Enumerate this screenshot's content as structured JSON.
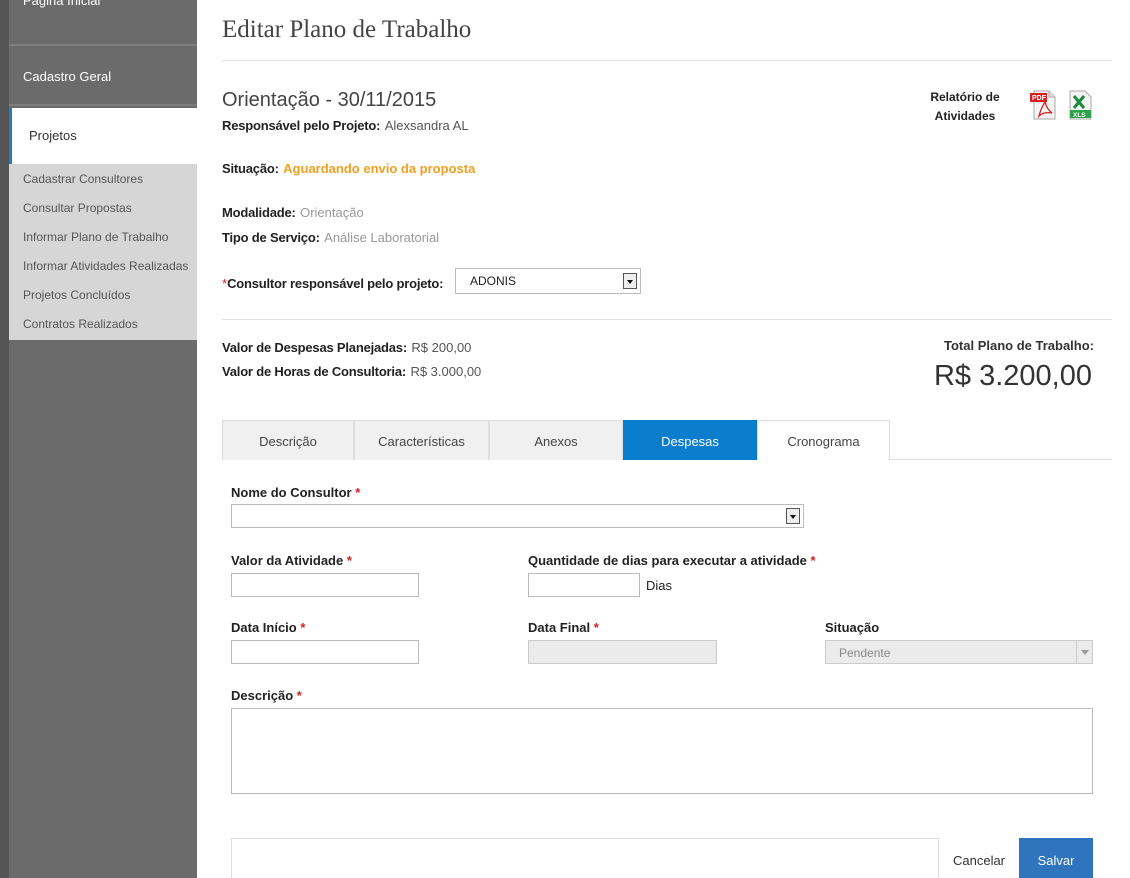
{
  "sidebar": {
    "home": "Página Inicial",
    "cadastro": "Cadastro Geral",
    "projetos": "Projetos",
    "sub_items": [
      "Cadastrar Consultores",
      "Consultar Propostas",
      "Informar Plano de Trabalho",
      "Informar Atividades Realizadas",
      "Projetos Concluídos",
      "Contratos Realizados"
    ]
  },
  "page": {
    "title": "Editar Plano de Trabalho"
  },
  "project": {
    "title": "Orientação - 30/11/2015",
    "responsavel_label": "Responsável pelo Projeto:",
    "responsavel_value": "Alexsandra AL",
    "situacao_label": "Situação:",
    "situacao_value": "Aguardando envio da proposta",
    "modalidade_label": "Modalidade:",
    "modalidade_value": "Orientação",
    "tipo_label": "Tipo de Serviço:",
    "tipo_value": "Análise Laboratorial",
    "consultor_label": "Consultor responsável pelo projeto:",
    "consultor_required": "*",
    "consultor_value": "ADONIS",
    "report_label": "Relatório de Atividades"
  },
  "totals": {
    "despesas_label": "Valor de Despesas Planejadas:",
    "despesas_value": "R$ 200,00",
    "horas_label": "Valor de Horas de Consultoria:",
    "horas_value": "R$ 3.000,00",
    "total_label": "Total Plano de Trabalho:",
    "total_value": "R$ 3.200,00"
  },
  "tabs": [
    "Descrição",
    "Características",
    "Anexos",
    "Despesas",
    "Cronograma"
  ],
  "form": {
    "required": "*",
    "nome_consultor": "Nome do Consultor",
    "valor_atividade": "Valor da Atividade",
    "qtd_dias": "Quantidade de dias para executar a atividade",
    "dias_suffix": "Dias",
    "data_inicio": "Data Início",
    "data_final": "Data Final",
    "situacao": "Situação",
    "situacao_value": "Pendente",
    "descricao": "Descrição"
  },
  "buttons": {
    "cancel": "Cancelar",
    "save": "Salvar"
  },
  "colors": {
    "accent": "#0a7ecd",
    "status": "#f0a020",
    "sidebar": "#6b6b6b"
  }
}
